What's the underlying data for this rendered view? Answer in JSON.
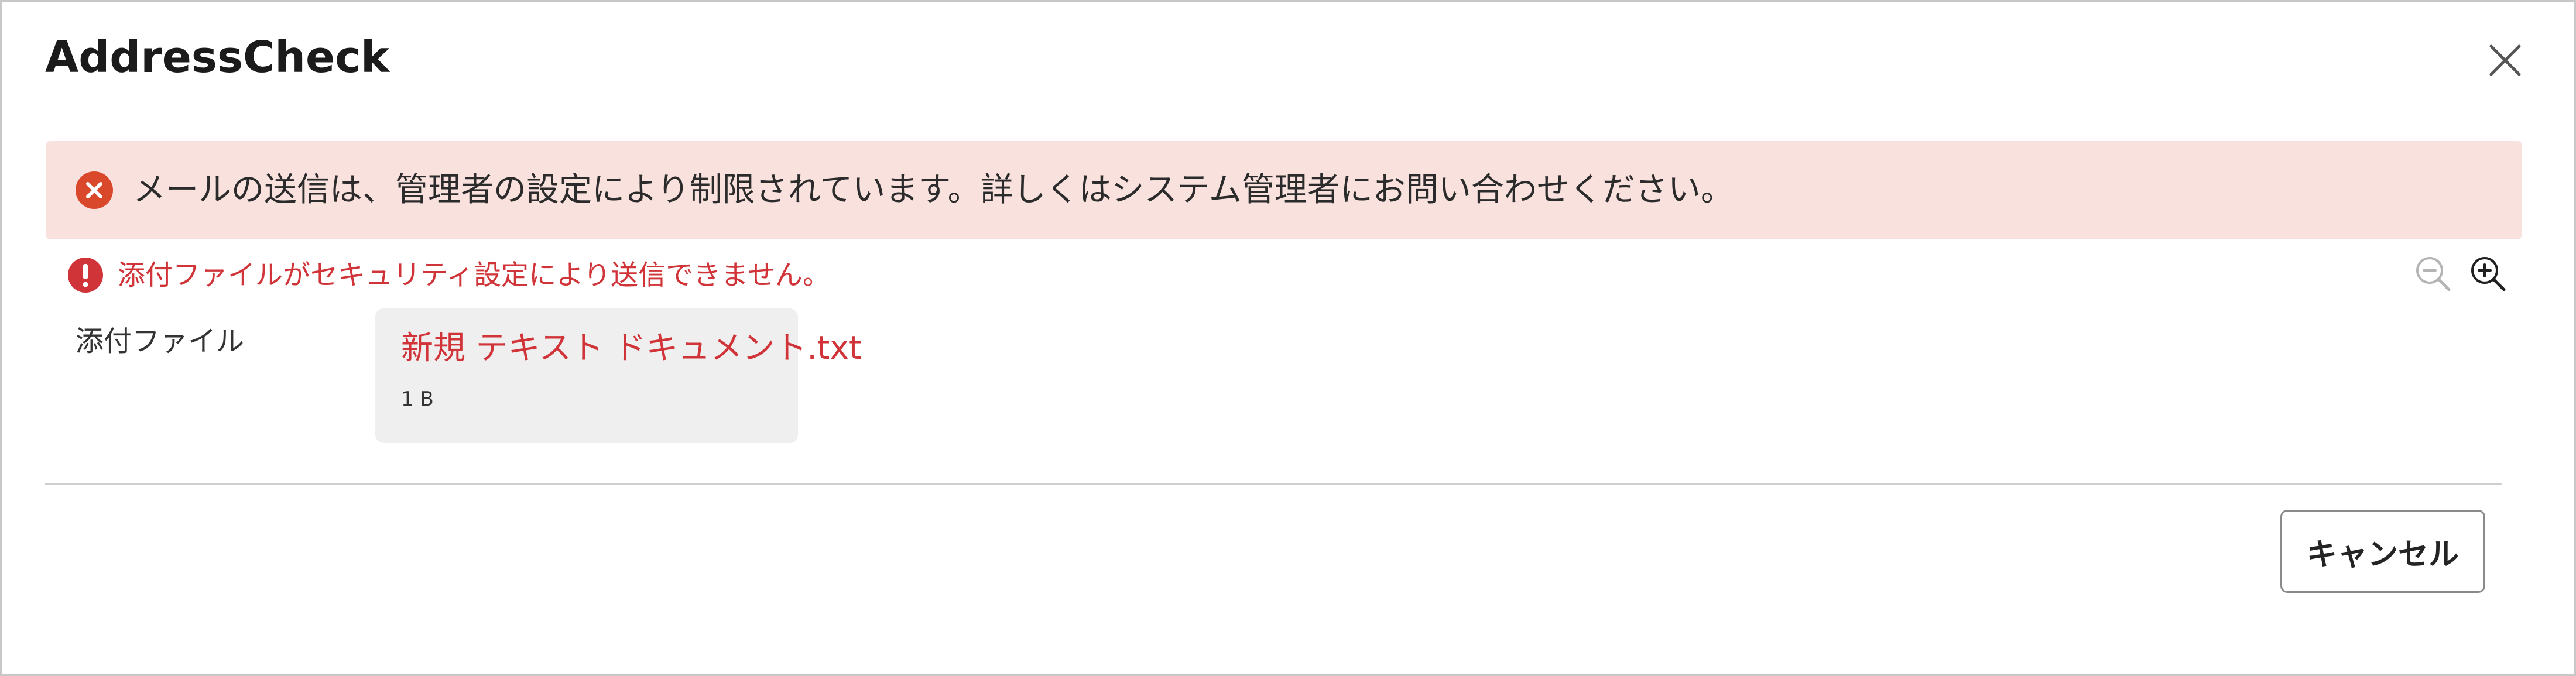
{
  "dialog": {
    "title": "AddressCheck",
    "close_icon": "close-icon"
  },
  "banner": {
    "icon": "error-circle-x-icon",
    "message": "メールの送信は、管理者の設定により制限されています。詳しくはシステム管理者にお問い合わせください。",
    "background_color": "#f9e1de",
    "icon_color": "#d9482b"
  },
  "security_error": {
    "icon": "exclamation-circle-icon",
    "message": "添付ファイルがセキュリティ設定により送信できません。",
    "color": "#d13438"
  },
  "zoom": {
    "zoom_out_icon": "zoom-out-icon",
    "zoom_in_icon": "zoom-in-icon"
  },
  "attachments": {
    "label": "添付ファイル",
    "items": [
      {
        "name": "新規 テキスト ドキュメント.txt",
        "size": "1 B"
      }
    ]
  },
  "footer": {
    "cancel_label": "キャンセル"
  }
}
